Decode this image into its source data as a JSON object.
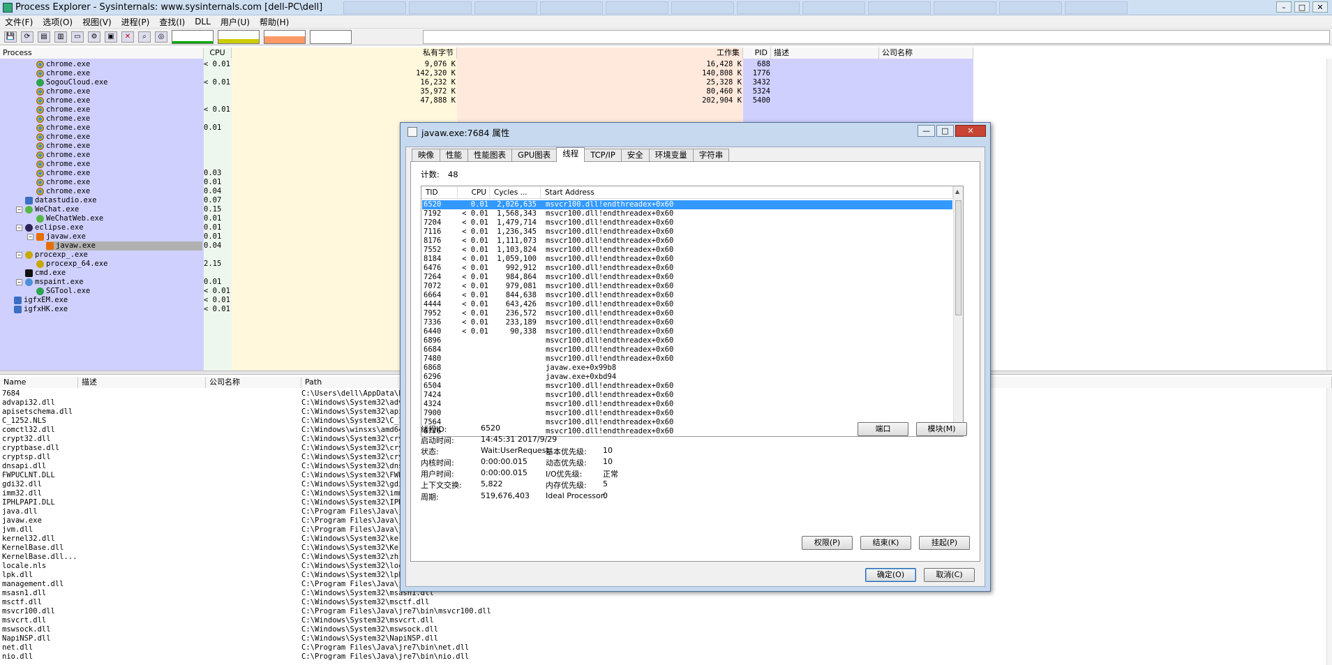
{
  "window": {
    "title": "Process Explorer - Sysinternals: www.sysinternals.com [dell-PC\\dell]",
    "controls": [
      "–",
      "□",
      "✕"
    ]
  },
  "menu": [
    "文件(F)",
    "选项(O)",
    "视图(V)",
    "进程(P)",
    "查找(I)",
    "DLL",
    "用户(U)",
    "帮助(H)"
  ],
  "toolbar": {
    "icons": [
      "save-icon",
      "refresh-icon",
      "system-info-icon",
      "properties-icon",
      "window-icon",
      "settings-icon",
      "properties-sheet-icon",
      "kill-process-icon",
      "find-icon",
      "target-icon"
    ],
    "glyphs": [
      "💾",
      "⟳",
      "▤",
      "▥",
      "▭",
      "⚙",
      "▣",
      "✕",
      "⌕",
      "◎"
    ]
  },
  "process_columns": {
    "process": "Process",
    "cpu": "CPU",
    "private_bytes": "私有字节",
    "working_set": "工作集",
    "pid": "PID",
    "description": "描述",
    "company": "公司名称"
  },
  "processes": [
    {
      "name": "chrome.exe",
      "indent": 3,
      "cpu": "< 0.01",
      "priv": "9,076 K",
      "ws": "16,428 K",
      "pid": "688",
      "icon": "chrome-icon"
    },
    {
      "name": "chrome.exe",
      "indent": 3,
      "cpu": "",
      "priv": "142,320 K",
      "ws": "140,808 K",
      "pid": "1776",
      "icon": "chrome-icon"
    },
    {
      "name": "SogouCloud.exe",
      "indent": 3,
      "cpu": "< 0.01",
      "priv": "16,232 K",
      "ws": "25,328 K",
      "pid": "3432",
      "icon": "sogou-icon"
    },
    {
      "name": "chrome.exe",
      "indent": 3,
      "cpu": "",
      "priv": "35,972 K",
      "ws": "80,460 K",
      "pid": "5324",
      "icon": "chrome-icon"
    },
    {
      "name": "chrome.exe",
      "indent": 3,
      "cpu": "",
      "priv": "47,888 K",
      "ws": "202,904 K",
      "pid": "5400",
      "icon": "chrome-icon"
    },
    {
      "name": "chrome.exe",
      "indent": 3,
      "cpu": "< 0.01",
      "priv": "",
      "ws": "",
      "pid": "",
      "icon": "chrome-icon"
    },
    {
      "name": "chrome.exe",
      "indent": 3,
      "cpu": "",
      "priv": "",
      "ws": "",
      "pid": "",
      "icon": "chrome-icon"
    },
    {
      "name": "chrome.exe",
      "indent": 3,
      "cpu": "0.01",
      "priv": "",
      "ws": "",
      "pid": "",
      "icon": "chrome-icon"
    },
    {
      "name": "chrome.exe",
      "indent": 3,
      "cpu": "",
      "priv": "",
      "ws": "",
      "pid": "",
      "icon": "chrome-icon"
    },
    {
      "name": "chrome.exe",
      "indent": 3,
      "cpu": "",
      "priv": "",
      "ws": "",
      "pid": "",
      "icon": "chrome-icon"
    },
    {
      "name": "chrome.exe",
      "indent": 3,
      "cpu": "",
      "priv": "",
      "ws": "",
      "pid": "",
      "icon": "chrome-icon"
    },
    {
      "name": "chrome.exe",
      "indent": 3,
      "cpu": "",
      "priv": "",
      "ws": "",
      "pid": "",
      "icon": "chrome-icon"
    },
    {
      "name": "chrome.exe",
      "indent": 3,
      "cpu": "0.03",
      "priv": "",
      "ws": "",
      "pid": "",
      "icon": "chrome-icon"
    },
    {
      "name": "chrome.exe",
      "indent": 3,
      "cpu": "0.01",
      "priv": "",
      "ws": "",
      "pid": "",
      "icon": "chrome-icon"
    },
    {
      "name": "chrome.exe",
      "indent": 3,
      "cpu": "0.04",
      "priv": "",
      "ws": "",
      "pid": "",
      "icon": "chrome-icon"
    },
    {
      "name": "datastudio.exe",
      "indent": 2,
      "cpu": "0.07",
      "priv": "",
      "ws": "",
      "pid": "",
      "icon": "app-icon"
    },
    {
      "name": "WeChat.exe",
      "indent": 2,
      "cpu": "0.15",
      "priv": "",
      "ws": "",
      "pid": "",
      "icon": "wechat-icon",
      "expand": "−"
    },
    {
      "name": "WeChatWeb.exe",
      "indent": 3,
      "cpu": "0.01",
      "priv": "",
      "ws": "",
      "pid": "",
      "icon": "wechat-icon"
    },
    {
      "name": "eclipse.exe",
      "indent": 2,
      "cpu": "0.01",
      "priv": "",
      "ws": "",
      "pid": "",
      "icon": "eclipse-icon",
      "expand": "−"
    },
    {
      "name": "javaw.exe",
      "indent": 3,
      "cpu": "0.01",
      "priv": "",
      "ws": "",
      "pid": "",
      "icon": "java-icon",
      "expand": "−"
    },
    {
      "name": "javaw.exe",
      "indent": 4,
      "cpu": "0.04",
      "priv": "",
      "ws": "",
      "pid": "",
      "icon": "java-icon",
      "selected": true
    },
    {
      "name": "procexp_.exe",
      "indent": 2,
      "cpu": "",
      "priv": "",
      "ws": "",
      "pid": "",
      "icon": "procexp-icon",
      "expand": "−"
    },
    {
      "name": "procexp_64.exe",
      "indent": 3,
      "cpu": "2.15",
      "priv": "",
      "ws": "",
      "pid": "",
      "icon": "procexp-icon"
    },
    {
      "name": "cmd.exe",
      "indent": 2,
      "cpu": "",
      "priv": "",
      "ws": "",
      "pid": "",
      "icon": "cmd-icon"
    },
    {
      "name": "mspaint.exe",
      "indent": 2,
      "cpu": "0.01",
      "priv": "",
      "ws": "",
      "pid": "",
      "icon": "paint-icon",
      "expand": "−"
    },
    {
      "name": "SGTool.exe",
      "indent": 3,
      "cpu": "< 0.01",
      "priv": "",
      "ws": "",
      "pid": "",
      "icon": "sogou-icon"
    },
    {
      "name": "igfxEM.exe",
      "indent": 1,
      "cpu": "< 0.01",
      "priv": "",
      "ws": "",
      "pid": "",
      "icon": "app-icon"
    },
    {
      "name": "igfxHK.exe",
      "indent": 1,
      "cpu": "< 0.01",
      "priv": "",
      "ws": "",
      "pid": "",
      "icon": "app-icon"
    }
  ],
  "dll_columns": {
    "name": "Name",
    "description": "描述",
    "company": "公司名称",
    "path": "Path"
  },
  "dlls": [
    {
      "name": "7684",
      "path": "C:\\Users\\dell\\AppData\\Lo"
    },
    {
      "name": "advapi32.dll",
      "path": "C:\\Windows\\System32\\advap"
    },
    {
      "name": "apisetschema.dll",
      "path": "C:\\Windows\\System32\\apise"
    },
    {
      "name": "C_1252.NLS",
      "path": "C:\\Windows\\System32\\C_125"
    },
    {
      "name": "comctl32.dll",
      "path": "C:\\Windows\\winsxs\\amd64_"
    },
    {
      "name": "crypt32.dll",
      "path": "C:\\Windows\\System32\\crypt"
    },
    {
      "name": "cryptbase.dll",
      "path": "C:\\Windows\\System32\\crypt"
    },
    {
      "name": "cryptsp.dll",
      "path": "C:\\Windows\\System32\\crypt"
    },
    {
      "name": "dnsapi.dll",
      "path": "C:\\Windows\\System32\\dnsap"
    },
    {
      "name": "FWPUCLNT.DLL",
      "path": "C:\\Windows\\System32\\FWPUC"
    },
    {
      "name": "gdi32.dll",
      "path": "C:\\Windows\\System32\\gdi32"
    },
    {
      "name": "imm32.dll",
      "path": "C:\\Windows\\System32\\imm32"
    },
    {
      "name": "IPHLPAPI.DLL",
      "path": "C:\\Windows\\System32\\IPHLP"
    },
    {
      "name": "java.dll",
      "path": "C:\\Program Files\\Java\\jr"
    },
    {
      "name": "javaw.exe",
      "path": "C:\\Program Files\\Java\\jr"
    },
    {
      "name": "jvm.dll",
      "path": "C:\\Program Files\\Java\\jr"
    },
    {
      "name": "kernel32.dll",
      "path": "C:\\Windows\\System32\\kerne"
    },
    {
      "name": "KernelBase.dll",
      "path": "C:\\Windows\\System32\\Kerne"
    },
    {
      "name": "KernelBase.dll...",
      "path": "C:\\Windows\\System32\\zh-CN"
    },
    {
      "name": "locale.nls",
      "path": "C:\\Windows\\System32\\local"
    },
    {
      "name": "lpk.dll",
      "path": "C:\\Windows\\System32\\lpk.d"
    },
    {
      "name": "management.dll",
      "path": "C:\\Program Files\\Java\\jr"
    },
    {
      "name": "msasn1.dll",
      "path": "C:\\Windows\\System32\\msasn1.dll"
    },
    {
      "name": "msctf.dll",
      "path": "C:\\Windows\\System32\\msctf.dll"
    },
    {
      "name": "msvcr100.dll",
      "path": "C:\\Program Files\\Java\\jre7\\bin\\msvcr100.dll"
    },
    {
      "name": "msvcrt.dll",
      "path": "C:\\Windows\\System32\\msvcrt.dll"
    },
    {
      "name": "mswsock.dll",
      "path": "C:\\Windows\\System32\\mswsock.dll"
    },
    {
      "name": "NapiNSP.dll",
      "path": "C:\\Windows\\System32\\NapiNSP.dll"
    },
    {
      "name": "net.dll",
      "path": "C:\\Program Files\\Java\\jre7\\bin\\net.dll"
    },
    {
      "name": "nio.dll",
      "path": "C:\\Program Files\\Java\\jre7\\bin\\nio.dll"
    }
  ],
  "dialog": {
    "title": "javaw.exe:7684 属性",
    "controls": [
      "—",
      "□",
      "✕"
    ],
    "tabs": [
      "映像",
      "性能",
      "性能图表",
      "GPU图表",
      "线程",
      "TCP/IP",
      "安全",
      "环境变量",
      "字符串"
    ],
    "active_tab": "线程",
    "count_label": "计数:",
    "count_value": "48",
    "thread_columns": {
      "tid": "TID",
      "cpu": "CPU",
      "cycles": "Cycles ...",
      "start": "Start Address"
    },
    "threads": [
      {
        "tid": "6520",
        "cpu": "0.01",
        "cycles": "2,026,635",
        "start": "msvcr100.dll!endthreadex+0x60",
        "selected": true
      },
      {
        "tid": "7192",
        "cpu": "< 0.01",
        "cycles": "1,568,343",
        "start": "msvcr100.dll!endthreadex+0x60"
      },
      {
        "tid": "7204",
        "cpu": "< 0.01",
        "cycles": "1,479,714",
        "start": "msvcr100.dll!endthreadex+0x60"
      },
      {
        "tid": "7116",
        "cpu": "< 0.01",
        "cycles": "1,236,345",
        "start": "msvcr100.dll!endthreadex+0x60"
      },
      {
        "tid": "8176",
        "cpu": "< 0.01",
        "cycles": "1,111,073",
        "start": "msvcr100.dll!endthreadex+0x60"
      },
      {
        "tid": "7552",
        "cpu": "< 0.01",
        "cycles": "1,103,824",
        "start": "msvcr100.dll!endthreadex+0x60"
      },
      {
        "tid": "8184",
        "cpu": "< 0.01",
        "cycles": "1,059,100",
        "start": "msvcr100.dll!endthreadex+0x60"
      },
      {
        "tid": "6476",
        "cpu": "< 0.01",
        "cycles": "992,912",
        "start": "msvcr100.dll!endthreadex+0x60"
      },
      {
        "tid": "7264",
        "cpu": "< 0.01",
        "cycles": "984,864",
        "start": "msvcr100.dll!endthreadex+0x60"
      },
      {
        "tid": "7072",
        "cpu": "< 0.01",
        "cycles": "979,081",
        "start": "msvcr100.dll!endthreadex+0x60"
      },
      {
        "tid": "6664",
        "cpu": "< 0.01",
        "cycles": "844,638",
        "start": "msvcr100.dll!endthreadex+0x60"
      },
      {
        "tid": "4444",
        "cpu": "< 0.01",
        "cycles": "643,426",
        "start": "msvcr100.dll!endthreadex+0x60"
      },
      {
        "tid": "7952",
        "cpu": "< 0.01",
        "cycles": "236,572",
        "start": "msvcr100.dll!endthreadex+0x60"
      },
      {
        "tid": "7336",
        "cpu": "< 0.01",
        "cycles": "233,189",
        "start": "msvcr100.dll!endthreadex+0x60"
      },
      {
        "tid": "6440",
        "cpu": "< 0.01",
        "cycles": "90,338",
        "start": "msvcr100.dll!endthreadex+0x60"
      },
      {
        "tid": "6896",
        "cpu": "",
        "cycles": "",
        "start": "msvcr100.dll!endthreadex+0x60"
      },
      {
        "tid": "6684",
        "cpu": "",
        "cycles": "",
        "start": "msvcr100.dll!endthreadex+0x60"
      },
      {
        "tid": "7480",
        "cpu": "",
        "cycles": "",
        "start": "msvcr100.dll!endthreadex+0x60"
      },
      {
        "tid": "6868",
        "cpu": "",
        "cycles": "",
        "start": "javaw.exe+0x99b8"
      },
      {
        "tid": "6296",
        "cpu": "",
        "cycles": "",
        "start": "javaw.exe+0xbd94"
      },
      {
        "tid": "6504",
        "cpu": "",
        "cycles": "",
        "start": "msvcr100.dll!endthreadex+0x60"
      },
      {
        "tid": "7424",
        "cpu": "",
        "cycles": "",
        "start": "msvcr100.dll!endthreadex+0x60"
      },
      {
        "tid": "4324",
        "cpu": "",
        "cycles": "",
        "start": "msvcr100.dll!endthreadex+0x60"
      },
      {
        "tid": "7900",
        "cpu": "",
        "cycles": "",
        "start": "msvcr100.dll!endthreadex+0x60"
      },
      {
        "tid": "7564",
        "cpu": "",
        "cycles": "",
        "start": "msvcr100.dll!endthreadex+0x60"
      },
      {
        "tid": "6776",
        "cpu": "",
        "cycles": "",
        "start": "msvcr100.dll!endthreadex+0x60"
      }
    ],
    "details_left": [
      {
        "label": "线程ID:",
        "value": "6520"
      },
      {
        "label": "启动时间:",
        "value": "14:45:31  2017/9/29"
      },
      {
        "label": "状态:",
        "value": "Wait:UserRequest"
      },
      {
        "label": "内核时间:",
        "value": "0:00:00.015"
      },
      {
        "label": "用户时间:",
        "value": "0:00:00.015"
      },
      {
        "label": "上下文交换:",
        "value": "5,822"
      },
      {
        "label": "周期:",
        "value": "519,676,403"
      }
    ],
    "details_right": [
      {
        "label": "基本优先级:",
        "value": "10"
      },
      {
        "label": "动态优先级:",
        "value": "10"
      },
      {
        "label": "I/O优先级:",
        "value": "正常"
      },
      {
        "label": "内存优先级:",
        "value": "5"
      },
      {
        "label": "Ideal Processor:",
        "value": "0"
      }
    ],
    "buttons": {
      "stack": "端口",
      "module": "模块(M)",
      "permission": "权限(P)",
      "kill": "结束(K)",
      "suspend": "挂起(P)",
      "ok": "确定(O)",
      "cancel": "取消(C)"
    }
  },
  "colors": {
    "cpu_col": "#eef7ee",
    "private_col": "#fff8dc",
    "working_col": "#ffe9dc",
    "highlight": "#d0d0ff",
    "selection": "#3399ff",
    "selected_proc": "#b0b0b0"
  }
}
